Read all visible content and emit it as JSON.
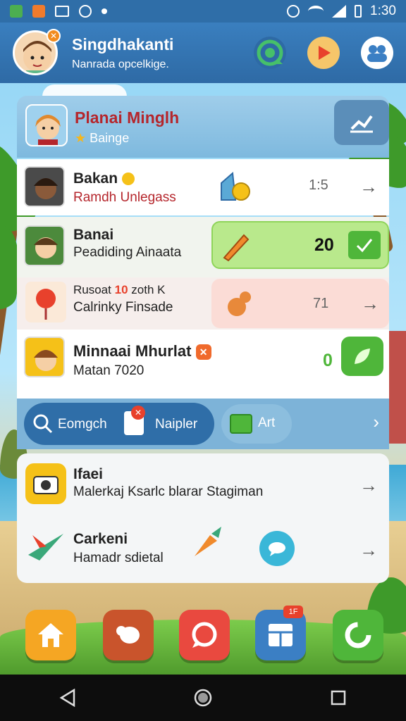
{
  "status_bar": {
    "time": "1:30",
    "icons": [
      "app-green-icon",
      "app-orange-icon",
      "cast-icon",
      "sync-icon",
      "dot-icon",
      "alarm-icon",
      "wifi-icon",
      "signal-icon",
      "battery-icon"
    ]
  },
  "header": {
    "title": "Singdhakanti",
    "subtitle": "Nanrada opcelkige.",
    "avatar_badge": "✕",
    "actions": [
      "refresh-chat-icon",
      "play-icon",
      "community-icon"
    ]
  },
  "profile": {
    "name": "Planai Minglh",
    "subtitle": "Bainge",
    "edit_icon": "edit-chart-icon"
  },
  "rows": [
    {
      "title": "Bakan",
      "subtitle": "Ramdh Unlegass",
      "value": "1:5",
      "icon": "toy-icon"
    },
    {
      "title": "Banai",
      "subtitle": "Peadiding Ainaata",
      "value": "20",
      "icon": "carrot-icon"
    },
    {
      "title": "Rusoat",
      "title_badge": "10",
      "title_extra": "zoth K",
      "subtitle": "Calrinky Finsade",
      "value": "71",
      "icon": "pet-icon"
    },
    {
      "title": "Minnaai Mhurlat",
      "subtitle": "Matan 7020",
      "value": "0",
      "icon": "leaf-icon"
    }
  ],
  "search": {
    "label": "Eomgch",
    "note_label": "Naipler",
    "note_badge": "✕",
    "art_label": "Art"
  },
  "bottom": [
    {
      "title": "Ifaei",
      "subtitle": "Malerkaj Ksarlc blarar Stagiman",
      "icon": "camera-icon"
    },
    {
      "title": "Carkeni",
      "subtitle": "Hamadr sdietal",
      "icon": "plane-icon"
    }
  ],
  "dock": [
    {
      "name": "home-icon",
      "color": "#f5a623"
    },
    {
      "name": "chat-bubble-icon",
      "color": "#c9542c"
    },
    {
      "name": "message-icon",
      "color": "#e9493f"
    },
    {
      "name": "grid-icon",
      "color": "#3b7fc4",
      "badge": "1F"
    },
    {
      "name": "refresh-icon",
      "color": "#4fb63a"
    }
  ],
  "nav": [
    "back-icon",
    "home-circle-icon",
    "recents-icon"
  ],
  "colors": {
    "header": "#2e6aa5",
    "accent_red": "#b5262c",
    "green": "#7ed957"
  }
}
